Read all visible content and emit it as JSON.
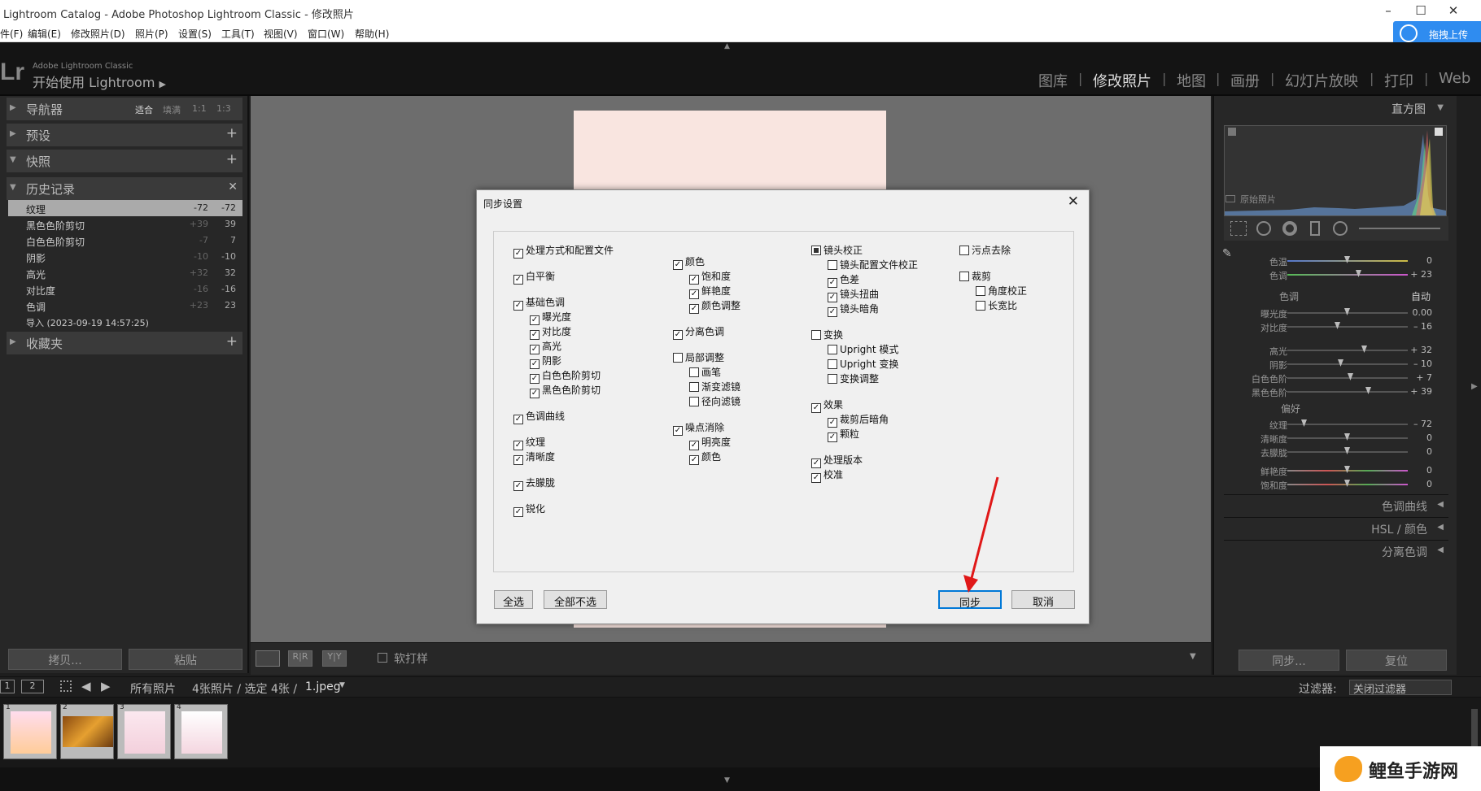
{
  "window": {
    "title": "Lightroom Catalog - Adobe Photoshop Lightroom Classic - 修改照片"
  },
  "menu": [
    "件(F)",
    "编辑(E)",
    "修改照片(D)",
    "照片(P)",
    "设置(S)",
    "工具(T)",
    "视图(V)",
    "窗口(W)",
    "帮助(H)"
  ],
  "baidu": {
    "label": "拖拽上传"
  },
  "brand": {
    "logo": "Lr",
    "line1": "Adobe Lightroom Classic",
    "line2": "开始使用 Lightroom",
    "arrow": "▶"
  },
  "modules": [
    "图库",
    "修改照片",
    "地图",
    "画册",
    "幻灯片放映",
    "打印",
    "Web"
  ],
  "left": {
    "navigator": {
      "label": "导航器",
      "options": [
        "适合",
        "填满",
        "1:1",
        "1:3"
      ]
    },
    "presets": "预设",
    "snapshots": "快照",
    "history": "历史记录",
    "collections": "收藏夹",
    "history_items": [
      {
        "name": "纹理",
        "a": "-72",
        "b": "-72"
      },
      {
        "name": "黑色色阶剪切",
        "a": "+39",
        "b": "39"
      },
      {
        "name": "白色色阶剪切",
        "a": "-7",
        "b": "7"
      },
      {
        "name": "阴影",
        "a": "-10",
        "b": "-10"
      },
      {
        "name": "高光",
        "a": "+32",
        "b": "32"
      },
      {
        "name": "对比度",
        "a": "-16",
        "b": "-16"
      },
      {
        "name": "色调",
        "a": "+23",
        "b": "23"
      },
      {
        "name": "导入 (2023-09-19 14:57:25)",
        "a": "",
        "b": ""
      }
    ],
    "copy": "拷贝...",
    "paste": "粘贴"
  },
  "toolbar": {
    "softproof": "软打样"
  },
  "right": {
    "histogram": "直方图",
    "original": "原始照片",
    "temp": {
      "label": "色温",
      "value": "0"
    },
    "tint": {
      "label": "色调",
      "value": "+ 23"
    },
    "tone": {
      "label": "色调",
      "auto": "自动"
    },
    "exposure": {
      "label": "曝光度",
      "value": "0.00"
    },
    "contrast": {
      "label": "对比度",
      "value": "– 16"
    },
    "highlights": {
      "label": "高光",
      "value": "+ 32"
    },
    "shadows": {
      "label": "阴影",
      "value": "– 10"
    },
    "whites": {
      "label": "白色色阶",
      "value": "+ 7"
    },
    "blacks": {
      "label": "黑色色阶",
      "value": "+ 39"
    },
    "presence": "偏好",
    "texture": {
      "label": "纹理",
      "value": "– 72"
    },
    "clarity": {
      "label": "清晰度",
      "value": "0"
    },
    "dehaze": {
      "label": "去朦胧",
      "value": "0"
    },
    "vibrance": {
      "label": "鲜艳度",
      "value": "0"
    },
    "saturation": {
      "label": "饱和度",
      "value": "0"
    },
    "tonecurve": "色调曲线",
    "hsl": "HSL / 颜色",
    "splittone": "分离色调",
    "sync": "同步...",
    "reset": "复位"
  },
  "filmbar": {
    "p1": "1",
    "p2": "2",
    "source": "所有照片",
    "count": "4张照片 / 选定 4张 /",
    "file": "1.jpeg",
    "filter_label": "过滤器:",
    "filter_value": "关闭过滤器"
  },
  "thumbs": [
    "1",
    "2",
    "3",
    "4"
  ],
  "watermark": "鲤鱼手游网",
  "dialog": {
    "title": "同步设置",
    "select_all": "全选",
    "select_none": "全部不选",
    "sync": "同步",
    "cancel": "取消",
    "c1": [
      "处理方式和配置文件",
      "白平衡",
      "基础色调",
      "曝光度",
      "对比度",
      "高光",
      "阴影",
      "白色色阶剪切",
      "黑色色阶剪切",
      "色调曲线",
      "纹理",
      "清晰度",
      "去朦胧",
      "锐化"
    ],
    "c2": [
      "颜色",
      "饱和度",
      "鲜艳度",
      "颜色调整",
      "分离色调",
      "局部调整",
      "画笔",
      "渐变滤镜",
      "径向滤镜",
      "噪点消除",
      "明亮度",
      "颜色"
    ],
    "c3": [
      "镜头校正",
      "镜头配置文件校正",
      "色差",
      "镜头扭曲",
      "镜头暗角",
      "变换",
      "Upright 模式",
      "Upright 变换",
      "变换调整",
      "效果",
      "裁剪后暗角",
      "颗粒",
      "处理版本",
      "校准"
    ],
    "c4": [
      "污点去除",
      "裁剪",
      "角度校正",
      "长宽比"
    ]
  }
}
